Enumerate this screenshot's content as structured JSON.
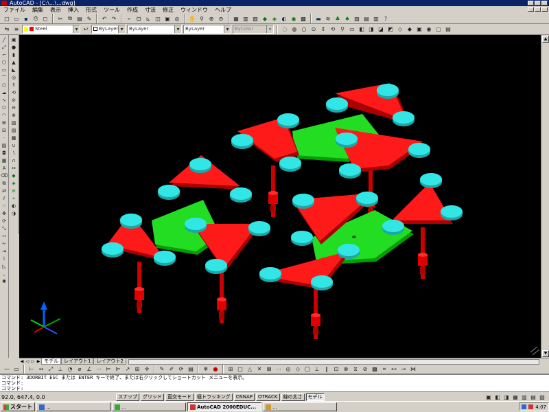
{
  "window": {
    "title": "AutoCAD - [C:\\...\\...dwg]",
    "controls": [
      "minimize",
      "maximize",
      "close"
    ]
  },
  "menu": {
    "items": [
      "ファイル",
      "編集",
      "表示",
      "挿入",
      "形式",
      "ツール",
      "作成",
      "寸法",
      "修正",
      "ウィンドウ",
      "ヘルプ"
    ]
  },
  "toolbar_properties": {
    "layer_combo": "Steel",
    "color_combo": "ByLayer",
    "linetype_combo": "ByLayer",
    "lineweight_combo": "ByLayer",
    "plotstyle_combo": "ByColor"
  },
  "layout_tabs": [
    "モデル",
    "レイアウト1",
    "レイアウト2"
  ],
  "command_lines": [
    "コマンド: 3DORBIT ESC または ENTER キーで終了、または右クリックしてショートカット メニューを表示。",
    "コマンド:",
    "コマンド:"
  ],
  "status": {
    "coords": "92.0, 647.4, 0.0",
    "buttons": [
      {
        "label": "スナップ",
        "on": false
      },
      {
        "label": "グリッド",
        "on": false
      },
      {
        "label": "直交モード",
        "on": false
      },
      {
        "label": "極トラッキング",
        "on": false
      },
      {
        "label": "OSNAP",
        "on": false
      },
      {
        "label": "OTRACK",
        "on": false
      },
      {
        "label": "線の太さ",
        "on": false
      },
      {
        "label": "モデル",
        "on": true
      }
    ]
  },
  "taskbar": {
    "start_label": "スタート",
    "items": [
      {
        "label": "...",
        "active": false
      },
      {
        "label": "...",
        "active": false
      },
      {
        "label": "AutoCAD 2000EDUC...",
        "active": true
      },
      {
        "label": "...",
        "active": false
      }
    ],
    "clock": "4:07"
  },
  "colors": {
    "triangles": "#ff0000",
    "hexagon_plates": "#00dd00",
    "pads": "#33e0e0",
    "posts": "#dd0000",
    "viewport_bg": "#000000"
  }
}
